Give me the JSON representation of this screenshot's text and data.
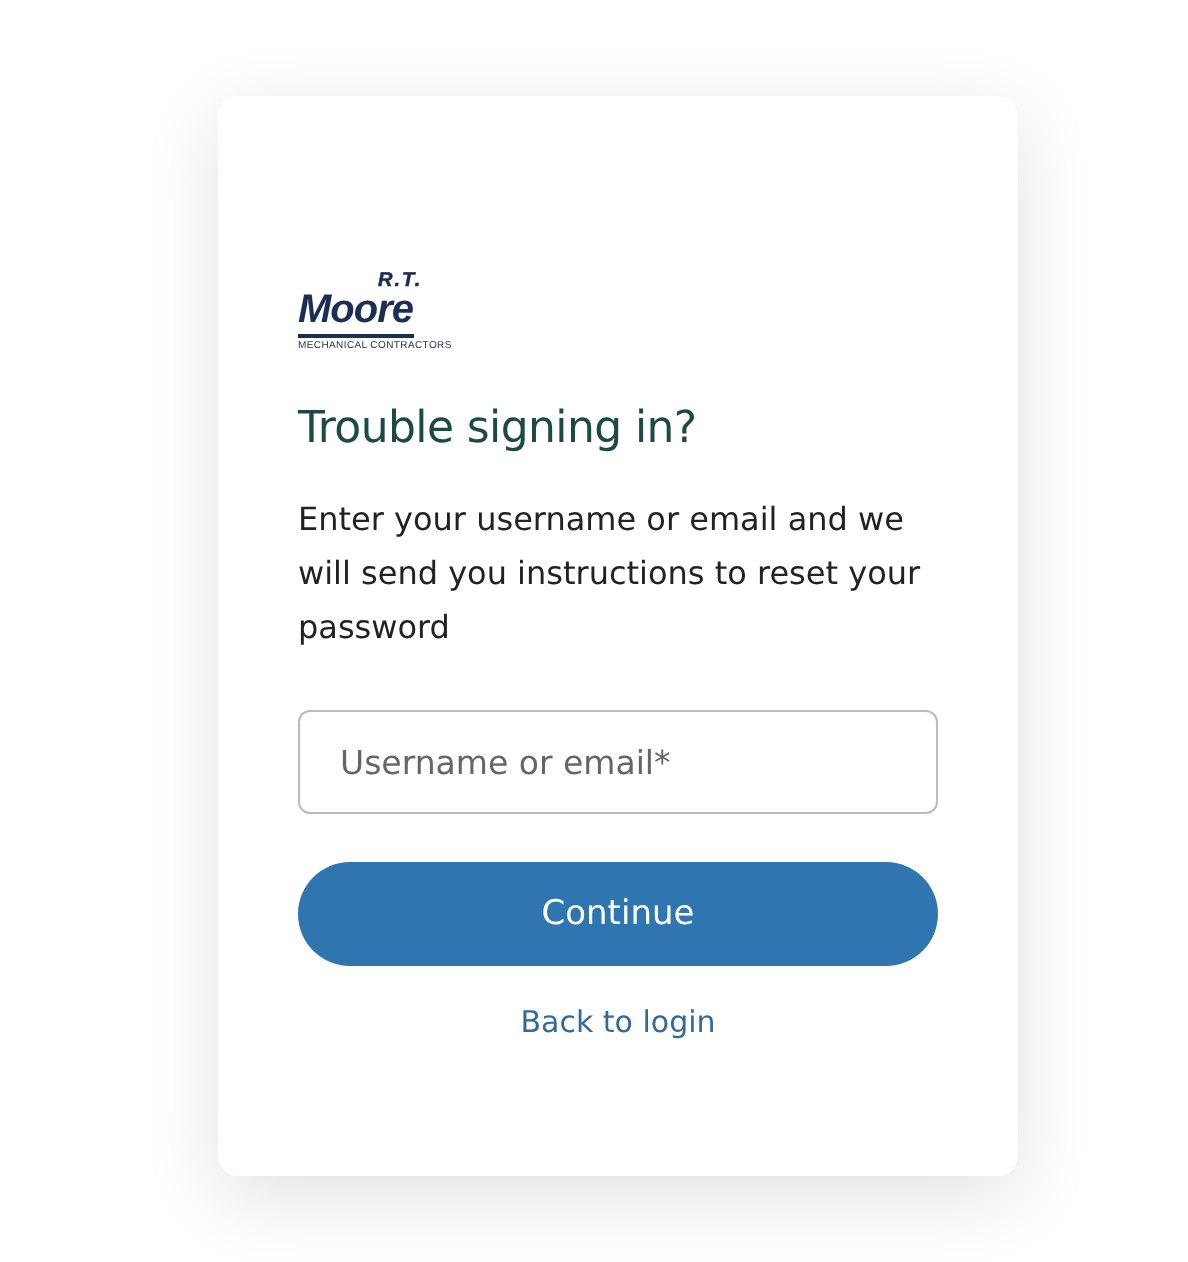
{
  "logo": {
    "initials": "R.T.",
    "name": "Moore",
    "tagline": "MECHANICAL CONTRACTORS"
  },
  "heading": "Trouble signing in?",
  "description": "Enter your username or email and we will send you instructions to reset your password",
  "field": {
    "placeholder": "Username or email*"
  },
  "button": "Continue",
  "link": "Back to login"
}
